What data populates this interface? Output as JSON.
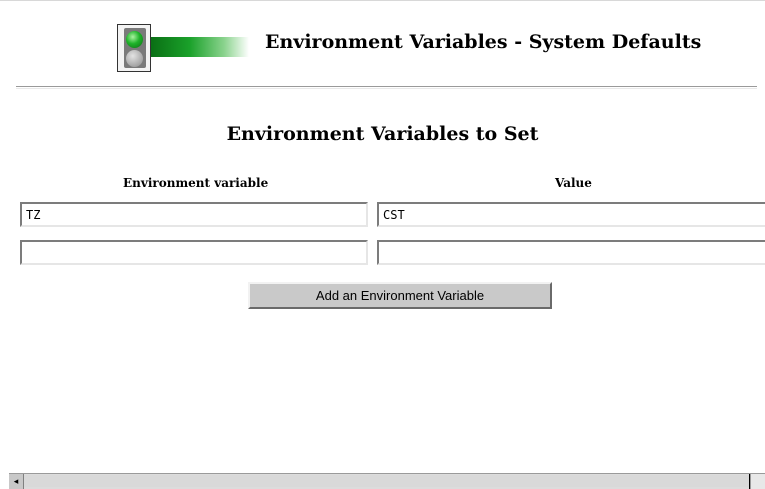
{
  "header": {
    "title": "Environment Variables - System Defaults",
    "logo_icon": "traffic-light-icon"
  },
  "section": {
    "title": "Environment Variables to Set"
  },
  "columns": {
    "variable": "Environment variable",
    "value": "Value"
  },
  "rows": [
    {
      "variable": "TZ",
      "value": "CST"
    },
    {
      "variable": "",
      "value": ""
    }
  ],
  "actions": {
    "add_label": "Add an Environment Variable"
  },
  "scrollbar": {
    "left_arrow": "◂"
  }
}
